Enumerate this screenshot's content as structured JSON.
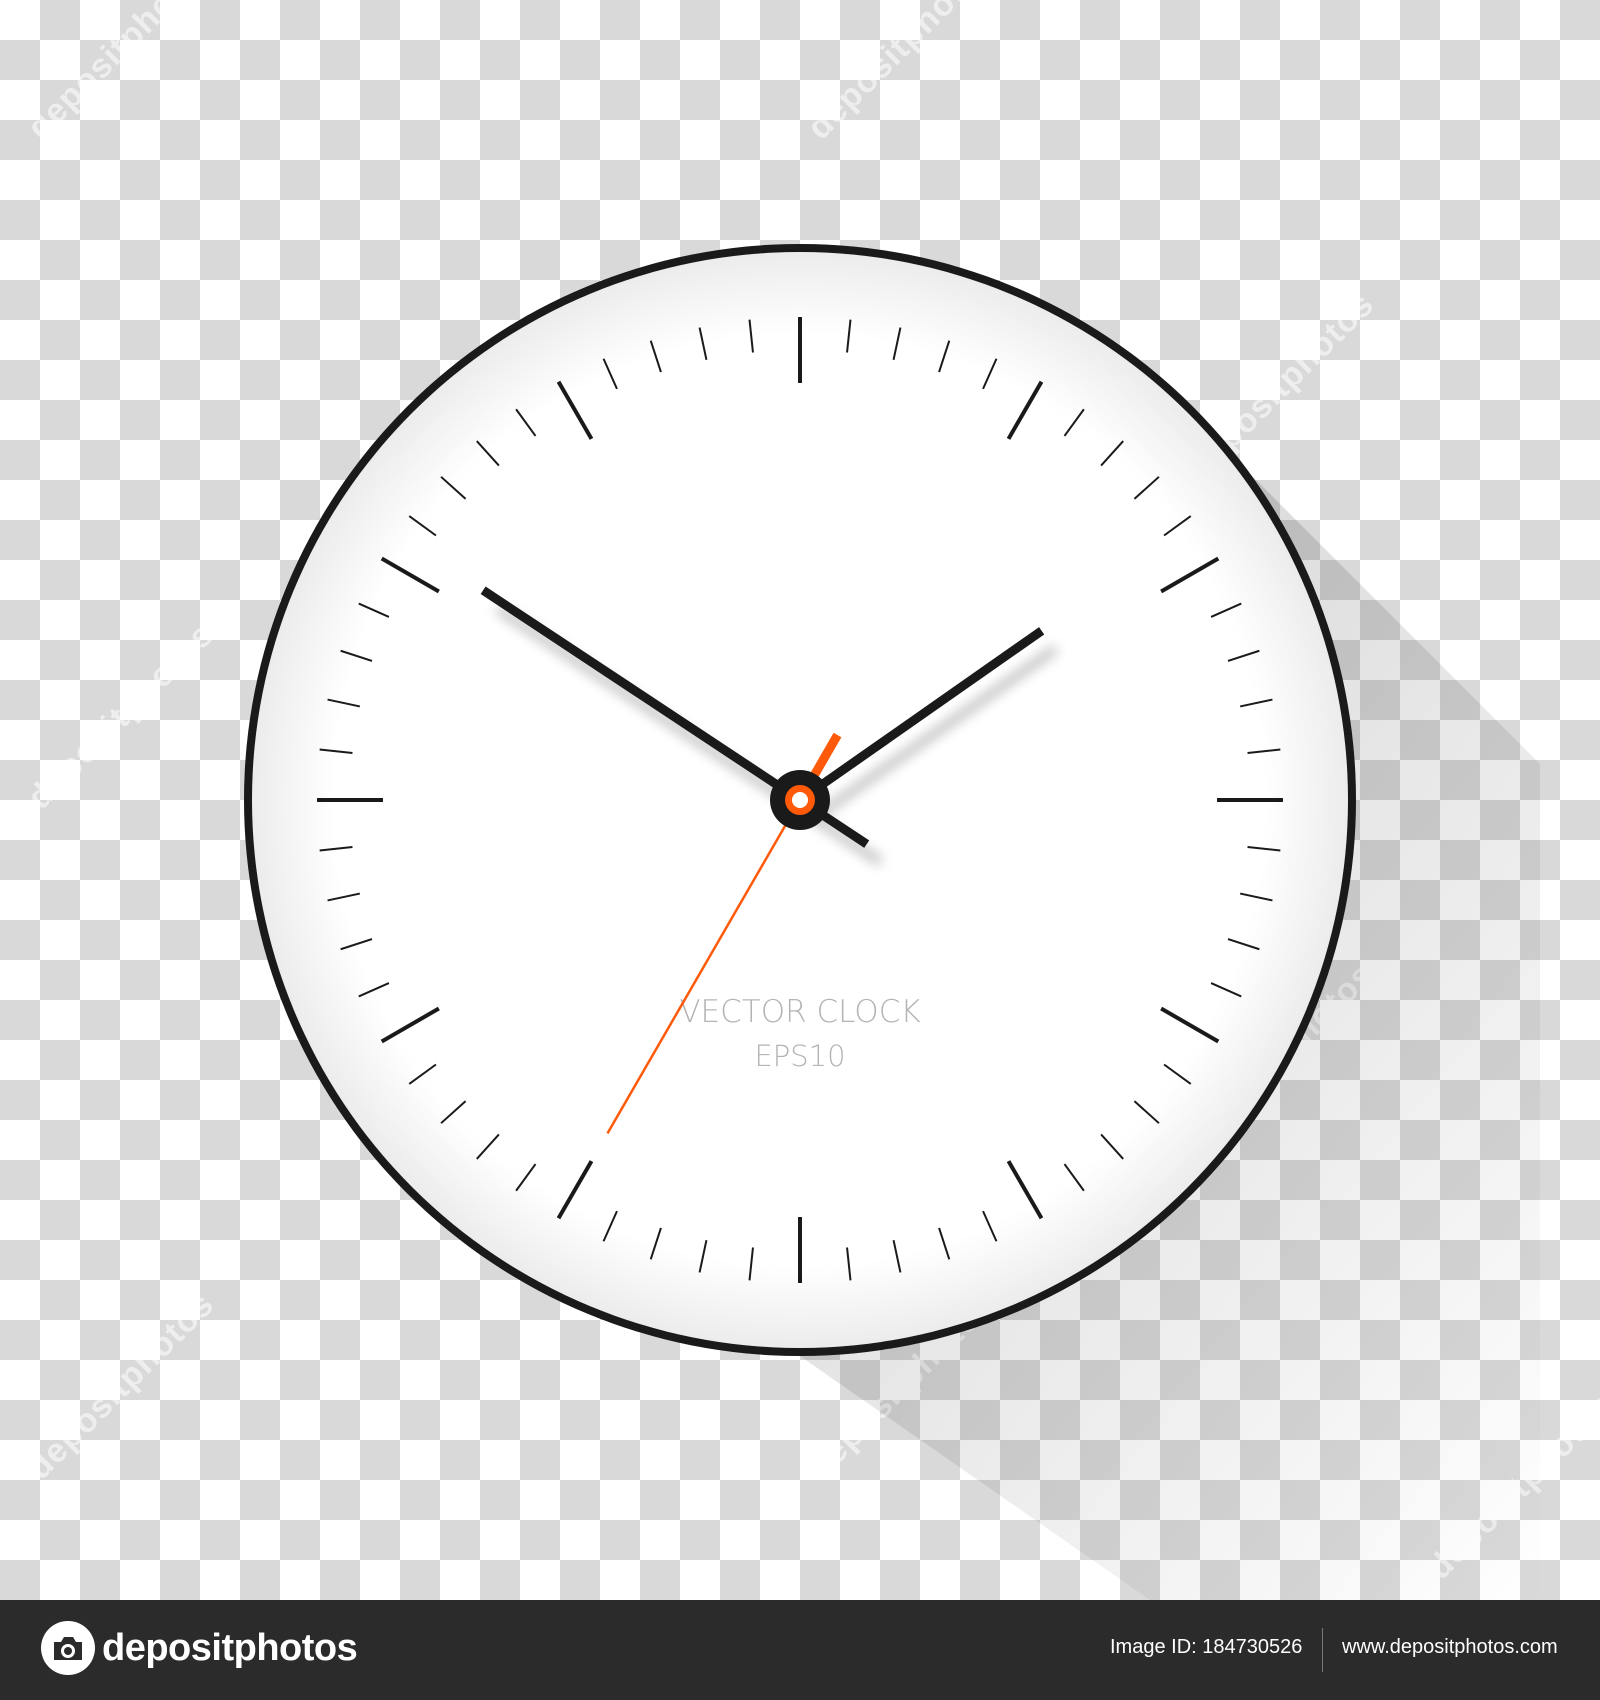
{
  "clock": {
    "line1": "VECTOR CLOCK",
    "line2": "EPS10",
    "time": {
      "hours": 1,
      "minutes": 50,
      "seconds": 35
    },
    "colors": {
      "hands": "#1a1a1a",
      "second_hand": "#ff5a0a",
      "face": "#ffffff",
      "rim": "#1a1a1a"
    }
  },
  "watermark": {
    "text": "depositphotos"
  },
  "footer": {
    "brand": "depositphotos",
    "image_id_label": "Image ID:",
    "image_id": "184730526",
    "site_url": "www.depositphotos.com"
  }
}
